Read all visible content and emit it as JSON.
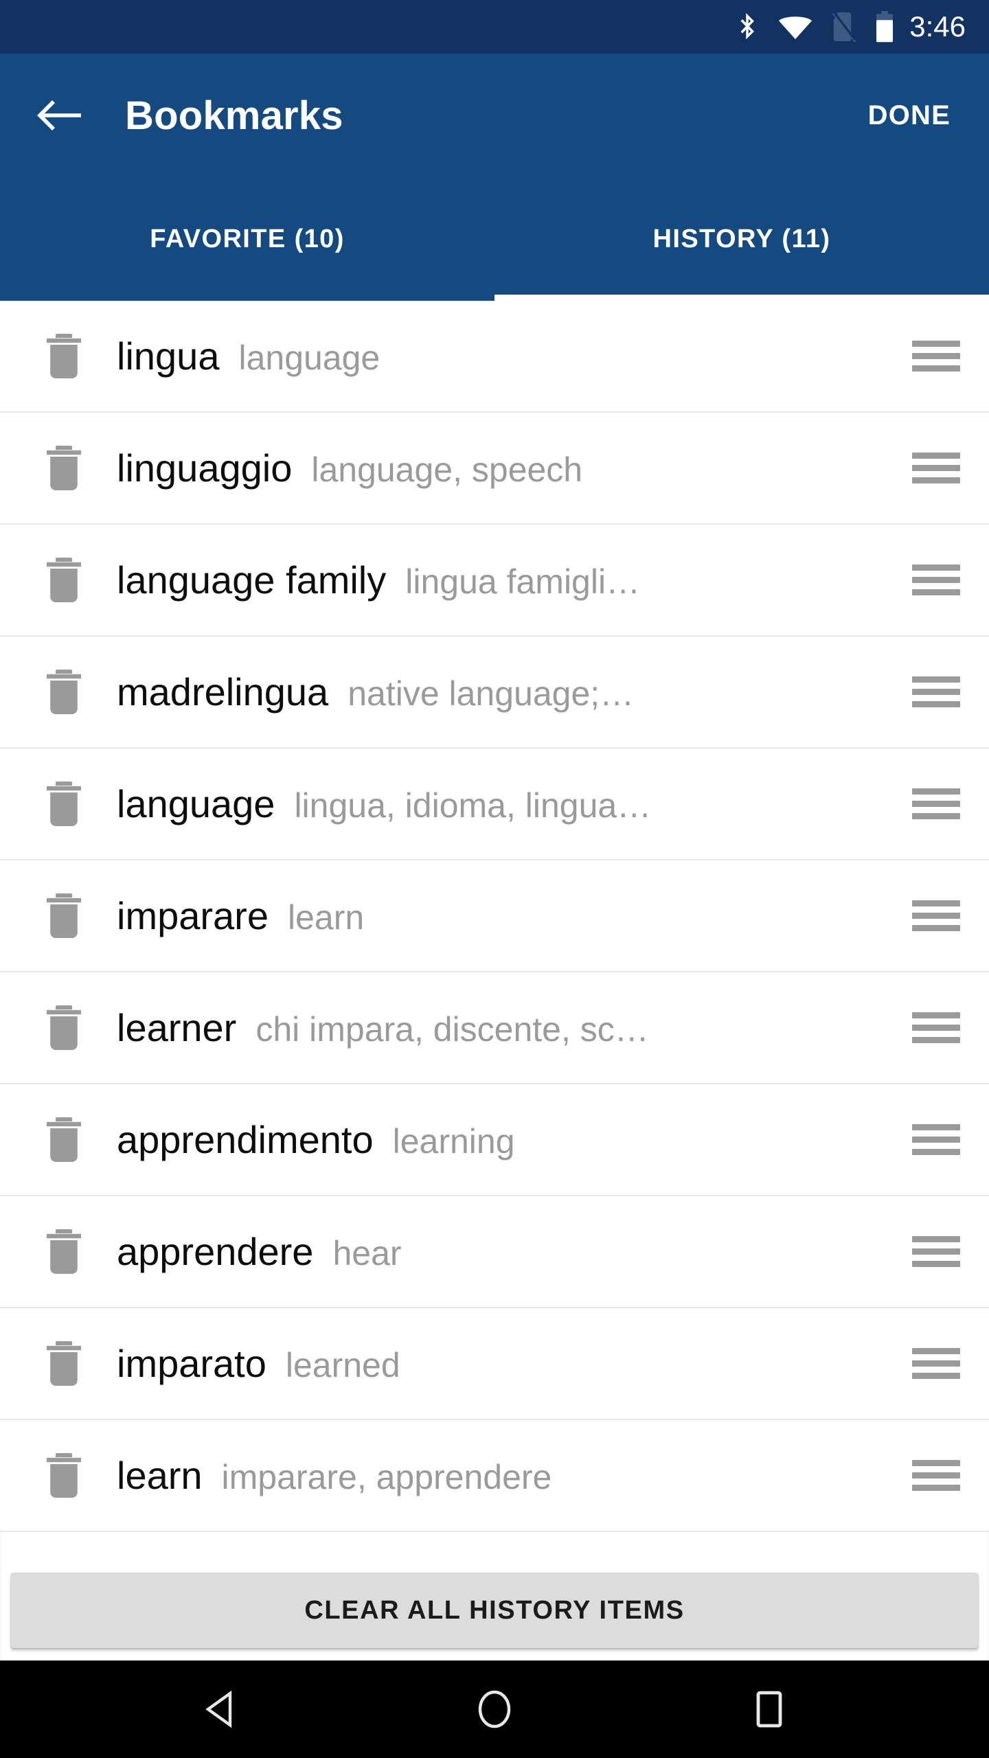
{
  "status_bar": {
    "icons": [
      "bluetooth-icon",
      "wifi-icon",
      "no-sim-icon",
      "battery-icon"
    ],
    "time": "3:46",
    "background": "#123262"
  },
  "app_bar": {
    "background": "#144A80",
    "back_icon": "back-arrow-icon",
    "title": "Bookmarks",
    "done_label": "DONE"
  },
  "tabs": [
    {
      "label": "FAVORITE (10)",
      "active": false
    },
    {
      "label": "HISTORY (11)",
      "active": true
    }
  ],
  "list": {
    "row_icons": {
      "delete": "trash-icon",
      "reorder": "drag-handle-icon"
    },
    "term_color": "#0d0d0d",
    "translation_color": "#9a9a9a",
    "rows": [
      {
        "term": "lingua",
        "translation": "language"
      },
      {
        "term": "linguaggio",
        "translation": "language, speech"
      },
      {
        "term": "language family",
        "translation": "lingua famigli…"
      },
      {
        "term": "madrelingua",
        "translation": "native language;…"
      },
      {
        "term": "language",
        "translation": "lingua, idioma, lingua…"
      },
      {
        "term": "imparare",
        "translation": "learn"
      },
      {
        "term": "learner",
        "translation": "chi impara, discente, sc…"
      },
      {
        "term": "apprendimento",
        "translation": "learning"
      },
      {
        "term": "apprendere",
        "translation": "hear"
      },
      {
        "term": "imparato",
        "translation": "learned"
      },
      {
        "term": "learn",
        "translation": "imparare, apprendere"
      }
    ]
  },
  "clear_button": {
    "label": "CLEAR ALL HISTORY ITEMS",
    "background": "#dcdcdc"
  },
  "nav_bar": {
    "background": "#000000",
    "buttons": [
      "back-nav-icon",
      "home-nav-icon",
      "recents-nav-icon"
    ]
  }
}
